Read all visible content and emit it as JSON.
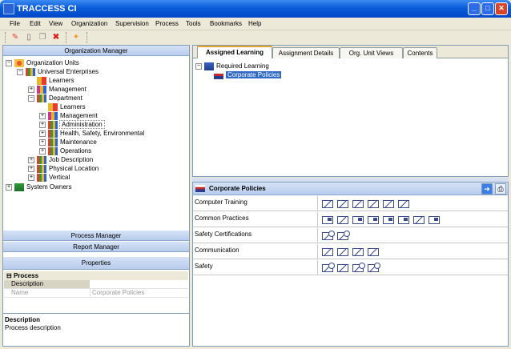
{
  "window": {
    "title": "TRACCESS CI"
  },
  "menu": [
    "File",
    "Edit",
    "View",
    "Organization",
    "Supervision",
    "Process",
    "Tools",
    "Bookmarks",
    "Help"
  ],
  "left": {
    "org_header": "Organization Manager",
    "process_header": "Process Manager",
    "report_header": "Report Manager",
    "properties_header": "Properties"
  },
  "tree": [
    {
      "label": "Organization Units"
    },
    {
      "label": "Universal Enterprises"
    },
    {
      "label": "Learners"
    },
    {
      "label": "Management"
    },
    {
      "label": "Department"
    },
    {
      "label": "Learners"
    },
    {
      "label": "Management"
    },
    {
      "label": "Administration"
    },
    {
      "label": "Health, Safety, Environmental"
    },
    {
      "label": "Maintenance"
    },
    {
      "label": "Operations"
    },
    {
      "label": "Job Description"
    },
    {
      "label": "Physical Location"
    },
    {
      "label": "Vertical"
    },
    {
      "label": "System Owners"
    }
  ],
  "properties": {
    "section": "Process",
    "rows": [
      {
        "name": "Description",
        "value": ""
      },
      {
        "name": "Name",
        "value": "Corporate Policies"
      }
    ],
    "desc_title": "Description",
    "desc_text": "Process description"
  },
  "tabs": [
    "Assigned Learning",
    "Assignment Details",
    "Org. Unit Views",
    "Contents"
  ],
  "assigned_tree": {
    "root": "Required Learning",
    "child": "Corporate Policies"
  },
  "detail": {
    "title": "Corporate Policies",
    "rows": [
      {
        "label": "Computer Training",
        "icons": 6
      },
      {
        "label": "Common Practices",
        "icons": 8
      },
      {
        "label": "Safety Certifications",
        "icons": 2
      },
      {
        "label": "Communication",
        "icons": 4
      },
      {
        "label": "Safety",
        "icons": 4
      }
    ]
  }
}
